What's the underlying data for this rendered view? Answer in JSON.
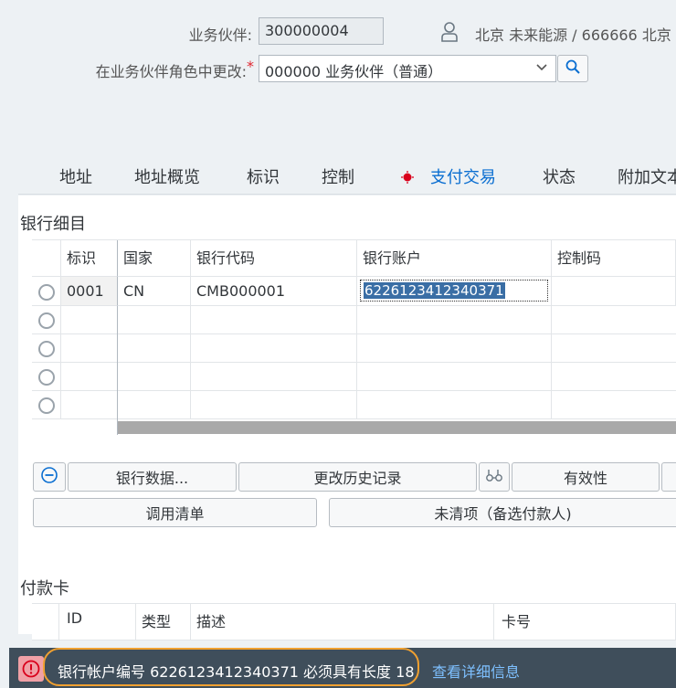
{
  "header": {
    "partner_label": "业务伙伴:",
    "partner_value": "300000004",
    "role_label": "在业务伙伴角色中更改:",
    "role_required_mark": "*",
    "role_value": "000000 业务伙伴（普通）",
    "partner_name": "北京 未来能源 / 666666 北京"
  },
  "tabs": [
    {
      "label": "地址"
    },
    {
      "label": "地址概览"
    },
    {
      "label": "标识"
    },
    {
      "label": "控制"
    },
    {
      "label": "支付交易"
    },
    {
      "label": "状态"
    },
    {
      "label": "附加文本"
    }
  ],
  "bank_section": {
    "title": "银行细目",
    "columns": [
      "标识",
      "国家",
      "银行代码",
      "银行账户",
      "控制码"
    ],
    "rows": [
      {
        "id": "0001",
        "country": "CN",
        "bank_code": "CMB000001",
        "account": "6226123412340371",
        "control": ""
      }
    ]
  },
  "buttons": {
    "bank_data": "银行数据...",
    "change_history": "更改历史记录",
    "validity": "有效性",
    "call_list": "调用清单",
    "open_items": "未清项（备选付款人)"
  },
  "card_section": {
    "title": "付款卡",
    "columns": [
      "ID",
      "类型",
      "描述",
      "卡号"
    ]
  },
  "message": {
    "text": "银行帐户编号 6226123412340371 必须具有长度 18",
    "details_link": "查看详细信息",
    "icon": "!"
  }
}
